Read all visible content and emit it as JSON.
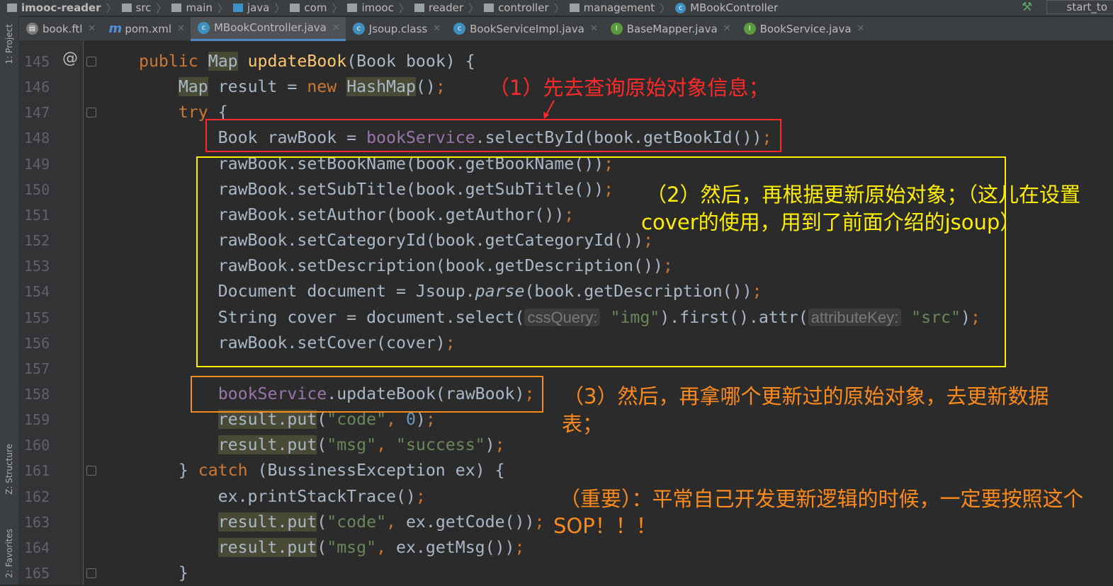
{
  "breadcrumb": [
    "imooc-reader",
    "src",
    "main",
    "java",
    "com",
    "imooc",
    "reader",
    "controller",
    "management",
    "MBookController"
  ],
  "run_config": "start_to",
  "tabs": [
    {
      "label": "book.ftl",
      "icon": "ftl-file-icon",
      "active": false
    },
    {
      "label": "pom.xml",
      "icon": "maven-icon",
      "active": false
    },
    {
      "label": "MBookController.java",
      "icon": "class-icon",
      "active": true
    },
    {
      "label": "Jsoup.class",
      "icon": "class-icon",
      "active": false
    },
    {
      "label": "BookServiceImpl.java",
      "icon": "class-icon",
      "active": false
    },
    {
      "label": "BaseMapper.java",
      "icon": "interface-icon",
      "active": false
    },
    {
      "label": "BookService.java",
      "icon": "interface-icon",
      "active": false
    }
  ],
  "side_tools": [
    "1: Project",
    "Z: Structure",
    "2: Favorites"
  ],
  "code_lines": [
    {
      "num": "145",
      "tokens": [
        [
          "public ",
          "k"
        ],
        [
          "Map",
          "hl"
        ],
        [
          " ",
          ""
        ],
        [
          "updateBook",
          "m"
        ],
        [
          "(Book book) {",
          ""
        ]
      ]
    },
    {
      "num": "146",
      "tokens": [
        [
          "    ",
          ""
        ],
        [
          "Map",
          "hl"
        ],
        [
          " result = ",
          ""
        ],
        [
          "new ",
          "k"
        ],
        [
          "HashMap",
          "hl"
        ],
        [
          "()",
          ""
        ],
        [
          ";",
          "k"
        ]
      ]
    },
    {
      "num": "147",
      "tokens": [
        [
          "    ",
          ""
        ],
        [
          "try",
          "k"
        ],
        [
          " {",
          ""
        ]
      ]
    },
    {
      "num": "148",
      "tokens": [
        [
          "        Book rawBook = ",
          ""
        ],
        [
          "bookService",
          "f"
        ],
        [
          ".selectById(book.getBookId())",
          ""
        ],
        [
          ";",
          "k"
        ]
      ]
    },
    {
      "num": "149",
      "tokens": [
        [
          "        rawBook.setBookName(book.getBookName())",
          ""
        ],
        [
          ";",
          "k"
        ]
      ]
    },
    {
      "num": "150",
      "tokens": [
        [
          "        rawBook.setSubTitle(book.getSubTitle())",
          ""
        ],
        [
          ";",
          "k"
        ]
      ]
    },
    {
      "num": "151",
      "tokens": [
        [
          "        rawBook.setAuthor(book.getAuthor())",
          ""
        ],
        [
          ";",
          "k"
        ]
      ]
    },
    {
      "num": "152",
      "tokens": [
        [
          "        rawBook.setCategoryId(book.getCategoryId())",
          ""
        ],
        [
          ";",
          "k"
        ]
      ]
    },
    {
      "num": "153",
      "tokens": [
        [
          "        rawBook.setDescription(book.getDescription())",
          ""
        ],
        [
          ";",
          "k"
        ]
      ]
    },
    {
      "num": "154",
      "tokens": [
        [
          "        Document document = Jsoup.",
          ""
        ],
        [
          "parse",
          "i"
        ],
        [
          "(book.getDescription())",
          ""
        ],
        [
          ";",
          "k"
        ]
      ]
    },
    {
      "num": "155",
      "tokens": [
        [
          "        String cover = document.select(",
          ""
        ],
        [
          "cssQuery:",
          "h"
        ],
        [
          " ",
          ""
        ],
        [
          "\"img\"",
          "s"
        ],
        [
          ").first().attr(",
          ""
        ],
        [
          "attributeKey:",
          "h"
        ],
        [
          " ",
          ""
        ],
        [
          "\"src\"",
          "s"
        ],
        [
          ")",
          ""
        ],
        [
          ";",
          "k"
        ]
      ]
    },
    {
      "num": "156",
      "tokens": [
        [
          "        rawBook.setCover(cover)",
          ""
        ],
        [
          ";",
          "k"
        ]
      ]
    },
    {
      "num": "157",
      "tokens": []
    },
    {
      "num": "158",
      "tokens": [
        [
          "        ",
          ""
        ],
        [
          "bookService",
          "f"
        ],
        [
          ".updateBook(rawBook)",
          ""
        ],
        [
          ";",
          "k"
        ]
      ]
    },
    {
      "num": "159",
      "tokens": [
        [
          "        ",
          ""
        ],
        [
          "result.put",
          "hl"
        ],
        [
          "(",
          ""
        ],
        [
          "\"code\"",
          "s"
        ],
        [
          ", ",
          "k"
        ],
        [
          "0",
          "n"
        ],
        [
          ")",
          ""
        ],
        [
          ";",
          "k"
        ]
      ]
    },
    {
      "num": "160",
      "tokens": [
        [
          "        ",
          ""
        ],
        [
          "result.put",
          "hl"
        ],
        [
          "(",
          ""
        ],
        [
          "\"msg\"",
          "s"
        ],
        [
          ", ",
          "k"
        ],
        [
          "\"success\"",
          "s"
        ],
        [
          ")",
          ""
        ],
        [
          ";",
          "k"
        ]
      ]
    },
    {
      "num": "161",
      "tokens": [
        [
          "    } ",
          ""
        ],
        [
          "catch ",
          "k"
        ],
        [
          "(BussinessException ex) {",
          ""
        ]
      ]
    },
    {
      "num": "162",
      "tokens": [
        [
          "        ex.printStackTrace()",
          ""
        ],
        [
          ";",
          "k"
        ]
      ]
    },
    {
      "num": "163",
      "tokens": [
        [
          "        ",
          ""
        ],
        [
          "result.put",
          "hl"
        ],
        [
          "(",
          ""
        ],
        [
          "\"code\"",
          "s"
        ],
        [
          ", ",
          "k"
        ],
        [
          "ex.getCode())",
          ""
        ],
        [
          ";",
          "k"
        ]
      ]
    },
    {
      "num": "164",
      "tokens": [
        [
          "        ",
          ""
        ],
        [
          "result.put",
          "hl"
        ],
        [
          "(",
          ""
        ],
        [
          "\"msg\"",
          "s"
        ],
        [
          ", ",
          "k"
        ],
        [
          "ex.getMsg())",
          ""
        ],
        [
          ";",
          "k"
        ]
      ]
    },
    {
      "num": "165",
      "tokens": [
        [
          "    }",
          ""
        ]
      ]
    }
  ],
  "annotations": {
    "step1": "（1）先去查询原始对象信息；",
    "step2_line1": "（2）然后，再根据更新原始对象；（这儿在设置",
    "step2_line2": "cover的使用，用到了前面介绍的jsoup）",
    "step3_line1": "（3）然后，再拿哪个更新过的原始对象，去更新数据",
    "step3_line2": "表；",
    "important_line1": "（重要）：平常自己开发更新逻辑的时候，一定要按照这个",
    "important_line2": "SOP！！！"
  },
  "colors": {
    "red": "#ff2a2a",
    "yellow": "#ffee00",
    "orange": "#ff8a1c",
    "background": "#2b2b2b"
  }
}
